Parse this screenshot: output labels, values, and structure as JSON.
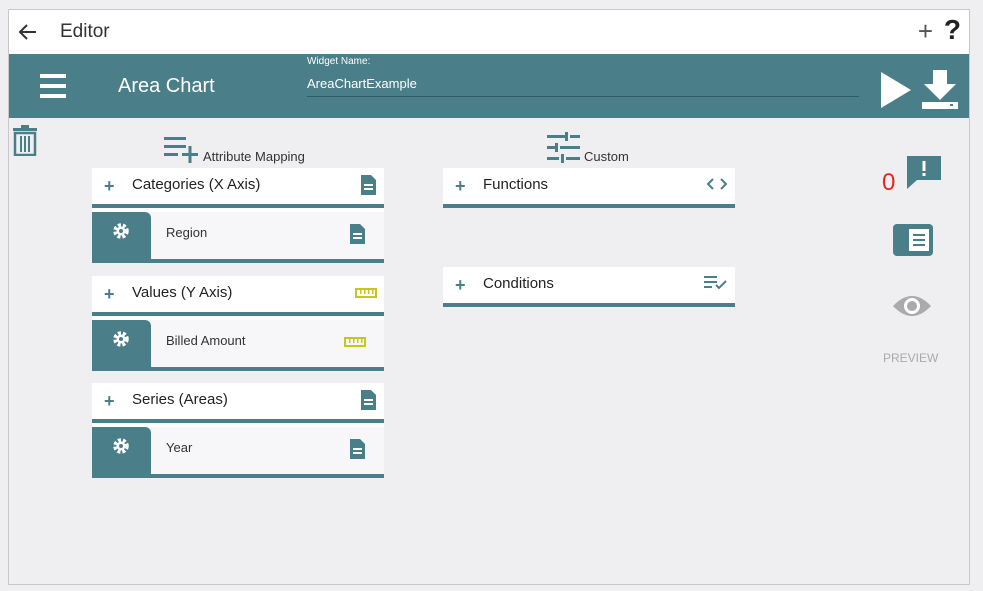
{
  "topbar": {
    "title": "Editor",
    "add_label": "+",
    "help_label": "?"
  },
  "header": {
    "chart_name": "Area Chart",
    "widget_name_label": "Widget Name:",
    "widget_name_value": "AreaChartExample"
  },
  "attribute_mapping": {
    "title": "Attribute Mapping",
    "groups": [
      {
        "label": "Categories (X Axis)",
        "icon": "document-icon",
        "item": "Region",
        "item_icon": "document-icon"
      },
      {
        "label": "Values (Y Axis)",
        "icon": "ruler-icon",
        "item": "Billed Amount",
        "item_icon": "ruler-icon"
      },
      {
        "label": "Series (Areas)",
        "icon": "document-icon",
        "item": "Year",
        "item_icon": "document-icon"
      }
    ]
  },
  "custom": {
    "title": "Custom",
    "functions_label": "Functions",
    "conditions_label": "Conditions"
  },
  "sidebar": {
    "message_count": "0",
    "preview_label": "PREVIEW"
  },
  "colors": {
    "teal": "#4a7f89",
    "ruler": "#c7c71a",
    "count": "#e8251f"
  }
}
